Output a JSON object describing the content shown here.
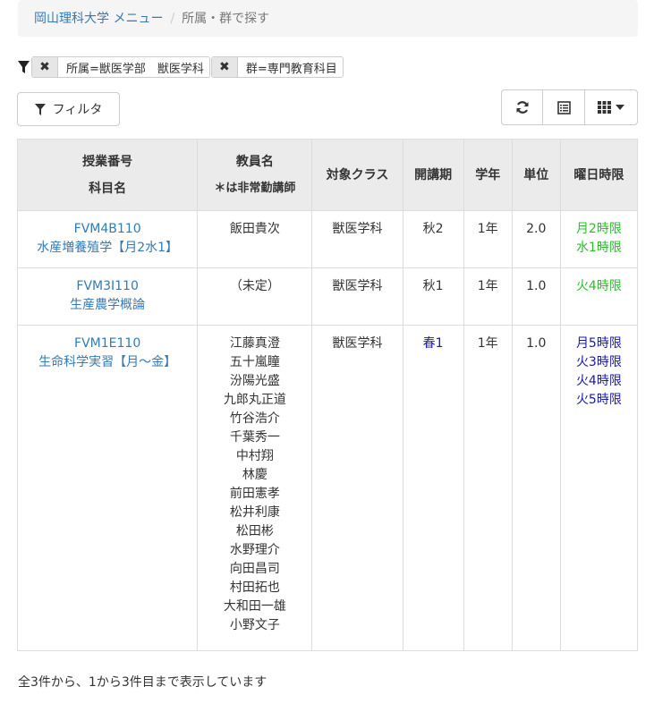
{
  "breadcrumb": {
    "home": "岡山理科大学 メニュー",
    "current": "所属・群で探す"
  },
  "filters": [
    {
      "label": "所属=獣医学部　獣医学科"
    },
    {
      "label": "群=専門教育科目"
    }
  ],
  "toolbar": {
    "filter_label": "フィルタ"
  },
  "table": {
    "headers": {
      "code_line1": "授業番号",
      "code_line2": "科目名",
      "teacher_line1": "教員名",
      "teacher_line2": "＊は非常勤講師",
      "class": "対象クラス",
      "term": "開講期",
      "year": "学年",
      "credits": "単位",
      "schedule": "曜日時限"
    },
    "rows": [
      {
        "code": "FVM4B110",
        "title": "水産増養殖学【月2水1】",
        "teachers": [
          "飯田貴次"
        ],
        "class": "獣医学科",
        "term": "秋2",
        "year": "1年",
        "credits": "2.0",
        "schedule": [
          "月2時限",
          "水1時限"
        ]
      },
      {
        "code": "FVM3I110",
        "title": "生産農学概論",
        "teachers": [
          "（未定）"
        ],
        "class": "獣医学科",
        "term": "秋1",
        "year": "1年",
        "credits": "1.0",
        "schedule": [
          "火4時限"
        ]
      },
      {
        "code": "FVM1E110",
        "title": "生命科学実習【月～金】",
        "teachers": [
          "江藤真澄",
          "五十嵐瞳",
          "汾陽光盛",
          "九郎丸正道",
          "竹谷浩介",
          "千葉秀一",
          "中村翔",
          "林慶",
          "前田憲孝",
          "松井利康",
          "松田彬",
          "水野理介",
          "向田昌司",
          "村田拓也",
          "大和田一雄",
          "小野文子"
        ],
        "class": "獣医学科",
        "term": "春1",
        "year": "1年",
        "credits": "1.0",
        "schedule": [
          "月5時限",
          "火3時限",
          "火4時限",
          "火5時限"
        ]
      }
    ]
  },
  "footer": {
    "summary": "全3件から、1から3件目まで表示しています"
  },
  "colors": {
    "link": "#337ab7",
    "autumn_schedule": "#2dbd2d",
    "spring_schedule": "#1a1aa6",
    "header_bg": "#ebebeb"
  }
}
